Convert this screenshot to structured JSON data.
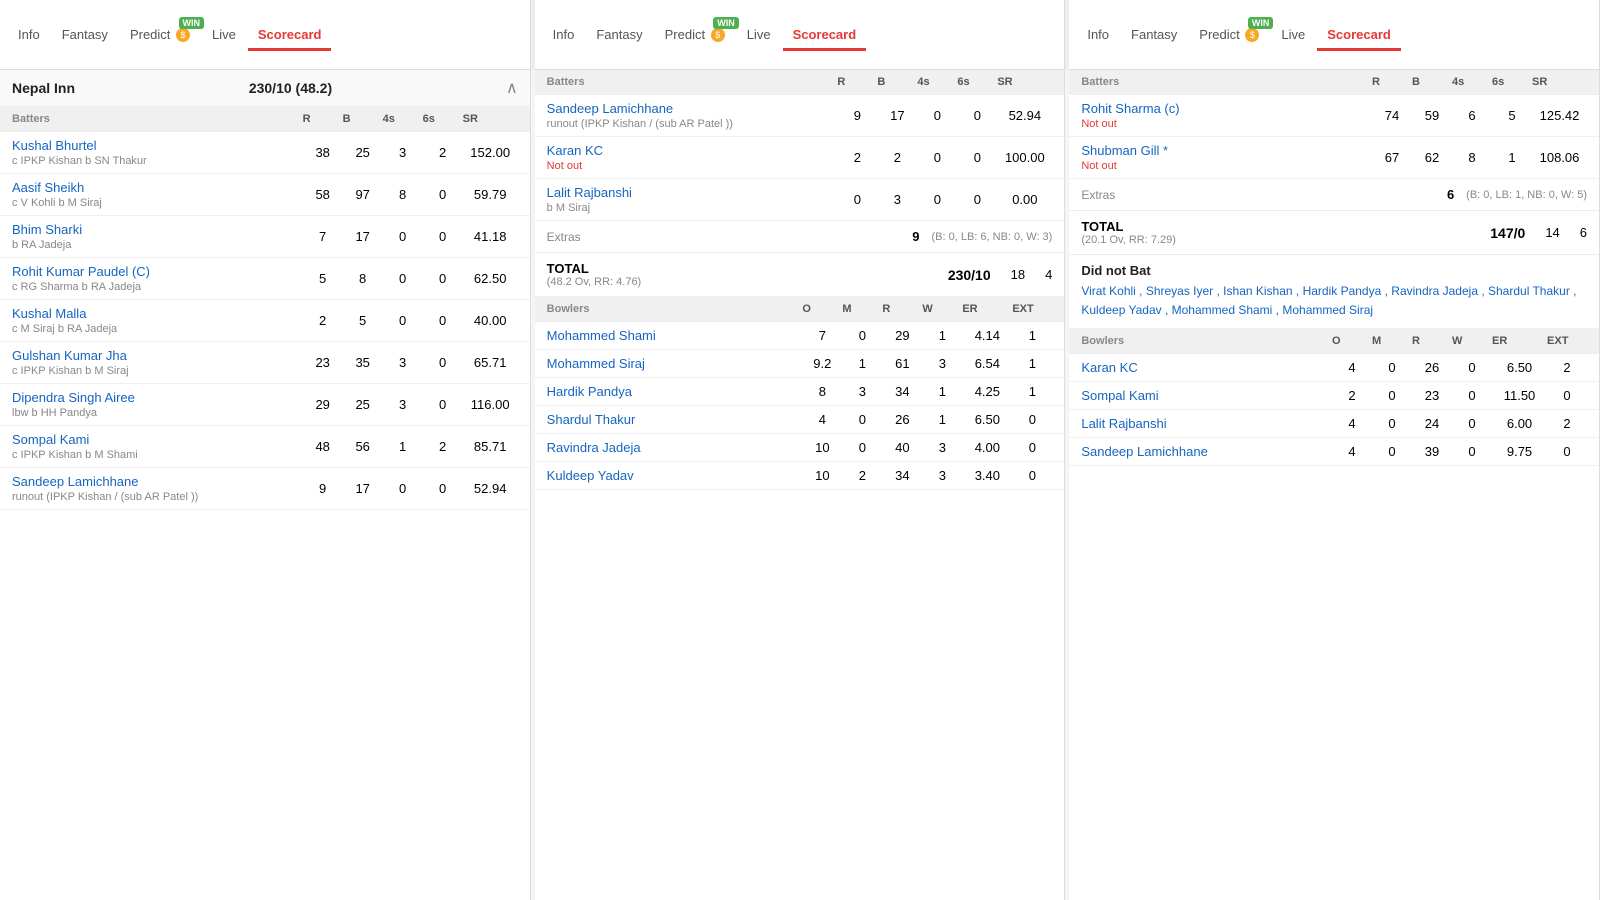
{
  "panels": [
    {
      "id": "nepal",
      "tabs": [
        {
          "label": "Info",
          "active": false
        },
        {
          "label": "Fantasy",
          "active": false
        },
        {
          "label": "Predict",
          "active": false,
          "win": true
        },
        {
          "label": "Live",
          "active": false
        },
        {
          "label": "Scorecard",
          "active": true
        }
      ],
      "innings": {
        "title": "Nepal Inn",
        "score": "230/10",
        "overs": "48.2",
        "batters_label": "Batters",
        "cols": [
          "R",
          "B",
          "4s",
          "6s",
          "SR"
        ],
        "batters": [
          {
            "name": "Kushal Bhurtel",
            "dismissal": "c IPKP Kishan b SN Thakur",
            "r": 38,
            "b": 25,
            "fours": 3,
            "sixes": 2,
            "sr": "152.00"
          },
          {
            "name": "Aasif Sheikh",
            "dismissal": "c V Kohli b M Siraj",
            "r": 58,
            "b": 97,
            "fours": 8,
            "sixes": 0,
            "sr": "59.79"
          },
          {
            "name": "Bhim Sharki",
            "dismissal": "b RA Jadeja",
            "r": 7,
            "b": 17,
            "fours": 0,
            "sixes": 0,
            "sr": "41.18"
          },
          {
            "name": "Rohit Kumar Paudel (C)",
            "dismissal": "c RG Sharma b RA Jadeja",
            "r": 5,
            "b": 8,
            "fours": 0,
            "sixes": 0,
            "sr": "62.50"
          },
          {
            "name": "Kushal Malla",
            "dismissal": "c M Siraj b RA Jadeja",
            "r": 2,
            "b": 5,
            "fours": 0,
            "sixes": 0,
            "sr": "40.00"
          },
          {
            "name": "Gulshan Kumar Jha",
            "dismissal": "c IPKP Kishan b M Siraj",
            "r": 23,
            "b": 35,
            "fours": 3,
            "sixes": 0,
            "sr": "65.71"
          },
          {
            "name": "Dipendra Singh Airee",
            "dismissal": "lbw b HH Pandya",
            "r": 29,
            "b": 25,
            "fours": 3,
            "sixes": 0,
            "sr": "116.00"
          },
          {
            "name": "Sompal Kami",
            "dismissal": "c IPKP Kishan b M Shami",
            "r": 48,
            "b": 56,
            "fours": 1,
            "sixes": 2,
            "sr": "85.71"
          },
          {
            "name": "Sandeep Lamichhane",
            "dismissal": "runout (IPKP Kishan / (sub AR Patel ))",
            "r": 9,
            "b": 17,
            "fours": 0,
            "sixes": 0,
            "sr": "52.94"
          }
        ],
        "extras_label": "Extras",
        "extras_value": "",
        "total_label": "TOTAL",
        "total_score": "230/10",
        "total_overs": "48.2 Ov, RR: 4.76",
        "total_4s": 18,
        "total_6s": 4,
        "bowlers_label": "Bowlers",
        "bowler_cols": [
          "O",
          "M",
          "R",
          "W",
          "ER",
          "EXT"
        ],
        "bowlers": []
      }
    },
    {
      "id": "nepal-bowling",
      "tabs": [
        {
          "label": "Info",
          "active": false
        },
        {
          "label": "Fantasy",
          "active": false
        },
        {
          "label": "Predict",
          "active": false,
          "win": true
        },
        {
          "label": "Live",
          "active": false
        },
        {
          "label": "Scorecard",
          "active": true
        }
      ],
      "innings": {
        "batters": [
          {
            "name": "Sandeep Lamichhane",
            "dismissal": "runout (IPKP Kishan / (sub AR Patel ))",
            "r": 9,
            "b": 17,
            "fours": 0,
            "sixes": 0,
            "sr": "52.94"
          },
          {
            "name": "Karan KC",
            "dismissal": "Not out",
            "not_out": true,
            "r": 2,
            "b": 2,
            "fours": 0,
            "sixes": 0,
            "sr": "100.00"
          },
          {
            "name": "Lalit Rajbanshi",
            "dismissal": "b M Siraj",
            "r": 0,
            "b": 3,
            "fours": 0,
            "sixes": 0,
            "sr": "0.00"
          }
        ],
        "extras_label": "Extras",
        "extras_value": 9,
        "extras_detail": "(B: 0, LB: 6, NB: 0, W: 3)",
        "total_label": "TOTAL",
        "total_score": "230/10",
        "total_overs": "48.2 Ov, RR: 4.76",
        "total_4s": 18,
        "total_6s": 4,
        "bowlers_label": "Bowlers",
        "bowler_cols": [
          "O",
          "M",
          "R",
          "W",
          "ER",
          "EXT"
        ],
        "bowlers": [
          {
            "name": "Mohammed Shami",
            "o": "7",
            "m": "0",
            "r": "29",
            "w": "1",
            "er": "4.14",
            "ext": "1"
          },
          {
            "name": "Mohammed Siraj",
            "o": "9.2",
            "m": "1",
            "r": "61",
            "w": "3",
            "er": "6.54",
            "ext": "1"
          },
          {
            "name": "Hardik Pandya",
            "o": "8",
            "m": "3",
            "r": "34",
            "w": "1",
            "er": "4.25",
            "ext": "1"
          },
          {
            "name": "Shardul Thakur",
            "o": "4",
            "m": "0",
            "r": "26",
            "w": "1",
            "er": "6.50",
            "ext": "0"
          },
          {
            "name": "Ravindra Jadeja",
            "o": "10",
            "m": "0",
            "r": "40",
            "w": "3",
            "er": "4.00",
            "ext": "0"
          },
          {
            "name": "Kuldeep Yadav",
            "o": "10",
            "m": "2",
            "r": "34",
            "w": "3",
            "er": "3.40",
            "ext": "0"
          }
        ]
      }
    },
    {
      "id": "india",
      "tabs": [
        {
          "label": "Info",
          "active": false
        },
        {
          "label": "Fantasy",
          "active": false
        },
        {
          "label": "Predict",
          "active": false,
          "win": true
        },
        {
          "label": "Live",
          "active": false
        },
        {
          "label": "Scorecard",
          "active": true
        }
      ],
      "innings": {
        "batters_label": "Batters",
        "cols": [
          "R",
          "B",
          "4s",
          "6s",
          "SR"
        ],
        "batters": [
          {
            "name": "Rohit Sharma (c)",
            "dismissal": "Not out",
            "not_out": true,
            "r": 74,
            "b": 59,
            "fours": 6,
            "sixes": 5,
            "sr": "125.42"
          },
          {
            "name": "Shubman Gill *",
            "dismissal": "Not out",
            "not_out": true,
            "r": 67,
            "b": 62,
            "fours": 8,
            "sixes": 1,
            "sr": "108.06"
          }
        ],
        "extras_label": "Extras",
        "extras_value": 6,
        "extras_detail": "(B: 0, LB: 1, NB: 0, W: 5)",
        "total_label": "TOTAL",
        "total_score": "147/0",
        "total_overs": "20.1 Ov, RR: 7.29",
        "total_4s": 14,
        "total_6s": 6,
        "did_not_bat_label": "Did not Bat",
        "did_not_bat_players": "Virat Kohli , Shreyas Iyer , Ishan Kishan , Hardik Pandya , Ravindra Jadeja , Shardul Thakur , Kuldeep Yadav , Mohammed Shami , Mohammed Siraj",
        "bowlers_label": "Bowlers",
        "bowler_cols": [
          "O",
          "M",
          "R",
          "W",
          "ER",
          "EXT"
        ],
        "bowlers": [
          {
            "name": "Karan KC",
            "o": "4",
            "m": "0",
            "r": "26",
            "w": "0",
            "er": "6.50",
            "ext": "2"
          },
          {
            "name": "Sompal Kami",
            "o": "2",
            "m": "0",
            "r": "23",
            "w": "0",
            "er": "11.50",
            "ext": "0"
          },
          {
            "name": "Lalit Rajbanshi",
            "o": "4",
            "m": "0",
            "r": "24",
            "w": "0",
            "er": "6.00",
            "ext": "2"
          },
          {
            "name": "Sandeep Lamichhane",
            "o": "4",
            "m": "0",
            "r": "39",
            "w": "0",
            "er": "9.75",
            "ext": "0"
          }
        ]
      }
    }
  ],
  "labels": {
    "info": "Info",
    "fantasy": "Fantasy",
    "predict": "Predict",
    "live": "Live",
    "scorecard": "Scorecard",
    "win": "WIN",
    "batters": "Batters",
    "bowlers": "Bowlers",
    "extras": "Extras",
    "total": "TOTAL",
    "did_not_bat": "Did not Bat",
    "not_out": "Not out",
    "col_r": "R",
    "col_b": "B",
    "col_4s": "4s",
    "col_6s": "6s",
    "col_sr": "SR",
    "col_o": "O",
    "col_m": "M",
    "col_w": "W",
    "col_er": "ER",
    "col_ext": "EXT"
  }
}
